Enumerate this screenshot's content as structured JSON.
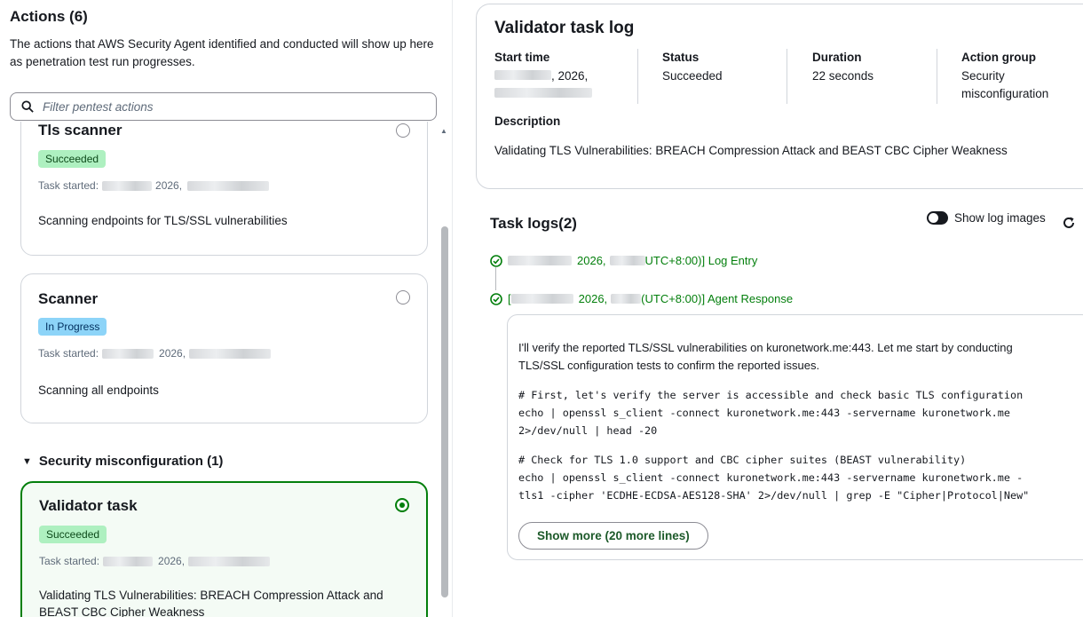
{
  "actions": {
    "title": "Actions (6)",
    "description": "The actions that AWS Security Agent identified and conducted will show up here as penetration test run progresses.",
    "filter_placeholder": "Filter pentest actions"
  },
  "cards": [
    {
      "title": "Tls scanner",
      "status": "Succeeded",
      "task_started_label": "Task started:",
      "year": "2026,",
      "description": "Scanning endpoints for TLS/SSL vulnerabilities",
      "selected": false
    },
    {
      "title": "Scanner",
      "status": "In Progress",
      "task_started_label": "Task started:",
      "year": "2026,",
      "description": "Scanning all endpoints",
      "selected": false
    },
    {
      "title": "Validator task",
      "status": "Succeeded",
      "task_started_label": "Task started:",
      "year": "2026,",
      "description": "Validating TLS Vulnerabilities: BREACH Compression Attack and BEAST CBC Cipher Weakness",
      "selected": true
    }
  ],
  "group": {
    "label": "Security misconfiguration (1)"
  },
  "log": {
    "title": "Validator task log",
    "start_time_label": "Start time",
    "start_time_year": ", 2026,",
    "status_label": "Status",
    "status_value": "Succeeded",
    "duration_label": "Duration",
    "duration_value": "22 seconds",
    "action_group_label": "Action group",
    "action_group_value": "Security misconfiguration",
    "description_label": "Description",
    "description_value": "Validating TLS Vulnerabilities: BREACH Compression Attack and BEAST CBC Cipher Weakness"
  },
  "task_logs": {
    "title": "Task logs(2)",
    "toggle_label": "Show log images",
    "entries": [
      {
        "year": "2026,",
        "suffix": "UTC+8:00)] Log Entry"
      },
      {
        "prefix": "[",
        "year": "2026,",
        "suffix": "(UTC+8:00)] Agent Response"
      }
    ],
    "response_text": "I'll verify the reported TLS/SSL vulnerabilities on kuronetwork.me:443. Let me start by conducting TLS/SSL configuration tests to confirm the reported issues.",
    "code_1": "# First, let's verify the server is accessible and check basic TLS configuration\necho | openssl s_client -connect kuronetwork.me:443 -servername kuronetwork.me\n2>/dev/null | head -20",
    "code_2": "# Check for TLS 1.0 support and CBC cipher suites (BEAST vulnerability)\necho | openssl s_client -connect kuronetwork.me:443 -servername kuronetwork.me -\ntls1 -cipher 'ECDHE-ECDSA-AES128-SHA' 2>/dev/null | grep -E \"Cipher|Protocol|New\"",
    "show_more_label": "Show more (20 more lines)"
  },
  "colors": {
    "success": "#037f0c",
    "in_progress_badge": "#8dd4f8",
    "succeeded_badge": "#aef0c0"
  }
}
